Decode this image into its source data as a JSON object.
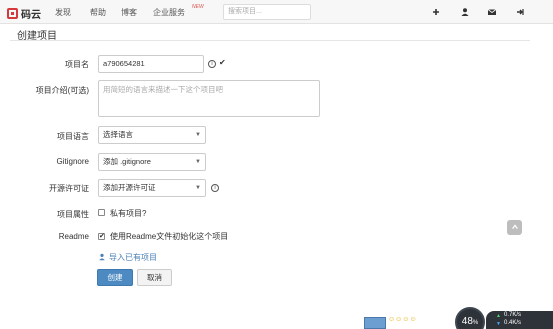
{
  "nav": {
    "logo_text": "码云",
    "links": [
      "发现",
      "帮助",
      "博客",
      "企业服务"
    ],
    "badge": "NEW",
    "search_placeholder": "搜索项目..."
  },
  "page": {
    "title": "创建项目"
  },
  "form": {
    "project_name_label": "项目名",
    "project_name_value": "a790654281",
    "intro_label": "项目介绍(可选)",
    "intro_placeholder": "用简短的语言来描述一下这个项目吧",
    "language_label": "项目语言",
    "language_value": "选择语言",
    "gitignore_label": "Gitignore",
    "gitignore_value": "添加 .gitignore",
    "license_label": "开源许可证",
    "license_value": "添加开源许可证",
    "attribute_label": "项目属性",
    "private_label": "私有项目?",
    "private_checked": false,
    "readme_label": "Readme",
    "readme_text": "使用Readme文件初始化这个项目",
    "readme_checked": true,
    "import_link": "导入已有项目",
    "create_button": "创建",
    "cancel_button": "取消"
  },
  "taskbar": {
    "gauge_value": "48",
    "gauge_unit": "%",
    "up_rate": "0.7K/s",
    "down_rate": "0.4K/s",
    "colors": {
      "up": "#55d36b",
      "down": "#4aa3ff"
    }
  }
}
